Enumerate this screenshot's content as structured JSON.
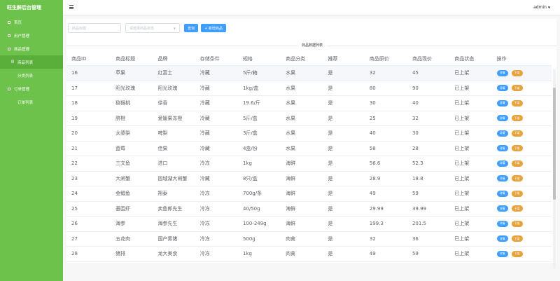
{
  "app": {
    "title": "旺生鲜后台管理"
  },
  "sidebar": {
    "items": [
      {
        "label": "首页",
        "icon": "home-icon"
      },
      {
        "label": "用户管理",
        "icon": "user-icon"
      },
      {
        "label": "商品管理",
        "icon": "goods-icon"
      },
      {
        "label": "商品列表",
        "icon": "list-icon"
      },
      {
        "label": "分类列表",
        "icon": ""
      },
      {
        "label": "订单管理",
        "icon": "order-icon"
      },
      {
        "label": "订单列表",
        "icon": ""
      }
    ]
  },
  "header": {
    "user": "admin"
  },
  "toolbar": {
    "title_placeholder": "商品标题",
    "status_placeholder": "请选择商品状态",
    "search_label": "查询",
    "add_label": "+ 新增商品"
  },
  "section": {
    "title": "商品数据列表"
  },
  "table": {
    "headers": [
      "商品ID",
      "商品标题",
      "品牌",
      "存储条件",
      "规格",
      "商品分类",
      "推荐",
      "商品原价",
      "商品现价",
      "商品状态",
      "操作"
    ],
    "edit_label": "详情",
    "down_label": "下架",
    "rows": [
      [
        "16",
        "苹果",
        "红富士",
        "冷藏",
        "5斤/箱",
        "水果",
        "是",
        "32",
        "45",
        "已上架"
      ],
      [
        "17",
        "阳光玫瑰",
        "阳光玫瑰",
        "冷藏",
        "1kg/盒",
        "水果",
        "是",
        "80",
        "90",
        "已上架"
      ],
      [
        "18",
        "猕猴桃",
        "徐香",
        "冷藏",
        "19.6/斤",
        "水果",
        "是",
        "30",
        "40",
        "已上架"
      ],
      [
        "19",
        "脐橙",
        "爱媛果冻橙",
        "冷藏",
        "5斤/盒",
        "水果",
        "是",
        "25",
        "32",
        "已上架"
      ],
      [
        "20",
        "太婆梨",
        "啤梨",
        "冷藏",
        "3斤/盒",
        "水果",
        "是",
        "40",
        "30",
        "已上架"
      ],
      [
        "21",
        "蓝莓",
        "佳果",
        "冷藏",
        "4盒/份",
        "水果",
        "是",
        "58",
        "28",
        "已上架"
      ],
      [
        "22",
        "三文鱼",
        "进口",
        "冷冻",
        "1kg",
        "海鲜",
        "是",
        "56.6",
        "52.3",
        "已上架"
      ],
      [
        "23",
        "大闸蟹",
        "固城湖大闸蟹",
        "冷藏",
        "8只/盒",
        "海鲜",
        "是",
        "28.9",
        "18.8",
        "已上架"
      ],
      [
        "24",
        "金鲳鱼",
        "翔泰",
        "冷冻",
        "700g/条",
        "海鲜",
        "是",
        "49",
        "59",
        "已上架"
      ],
      [
        "25",
        "基围虾",
        "卖鱼郎先生",
        "冷冻",
        "40/50g",
        "海鲜",
        "是",
        "29.99",
        "39.99",
        "已上架"
      ],
      [
        "26",
        "海参",
        "海参先生",
        "冷冻",
        "100-249g",
        "海鲜",
        "是",
        "199.3",
        "201.5",
        "已上架"
      ],
      [
        "27",
        "五花肉",
        "国产黑猪",
        "冷冻",
        "500g",
        "肉禽",
        "是",
        "32",
        "36",
        "已上架"
      ],
      [
        "28",
        "猪排",
        "龙大美食",
        "冷冻",
        "1kg",
        "肉禽",
        "是",
        "49",
        "59",
        "已上架"
      ]
    ]
  },
  "colors": {
    "sidebar": "#6cc24a",
    "primary": "#409eff",
    "warning": "#e6a23c"
  }
}
